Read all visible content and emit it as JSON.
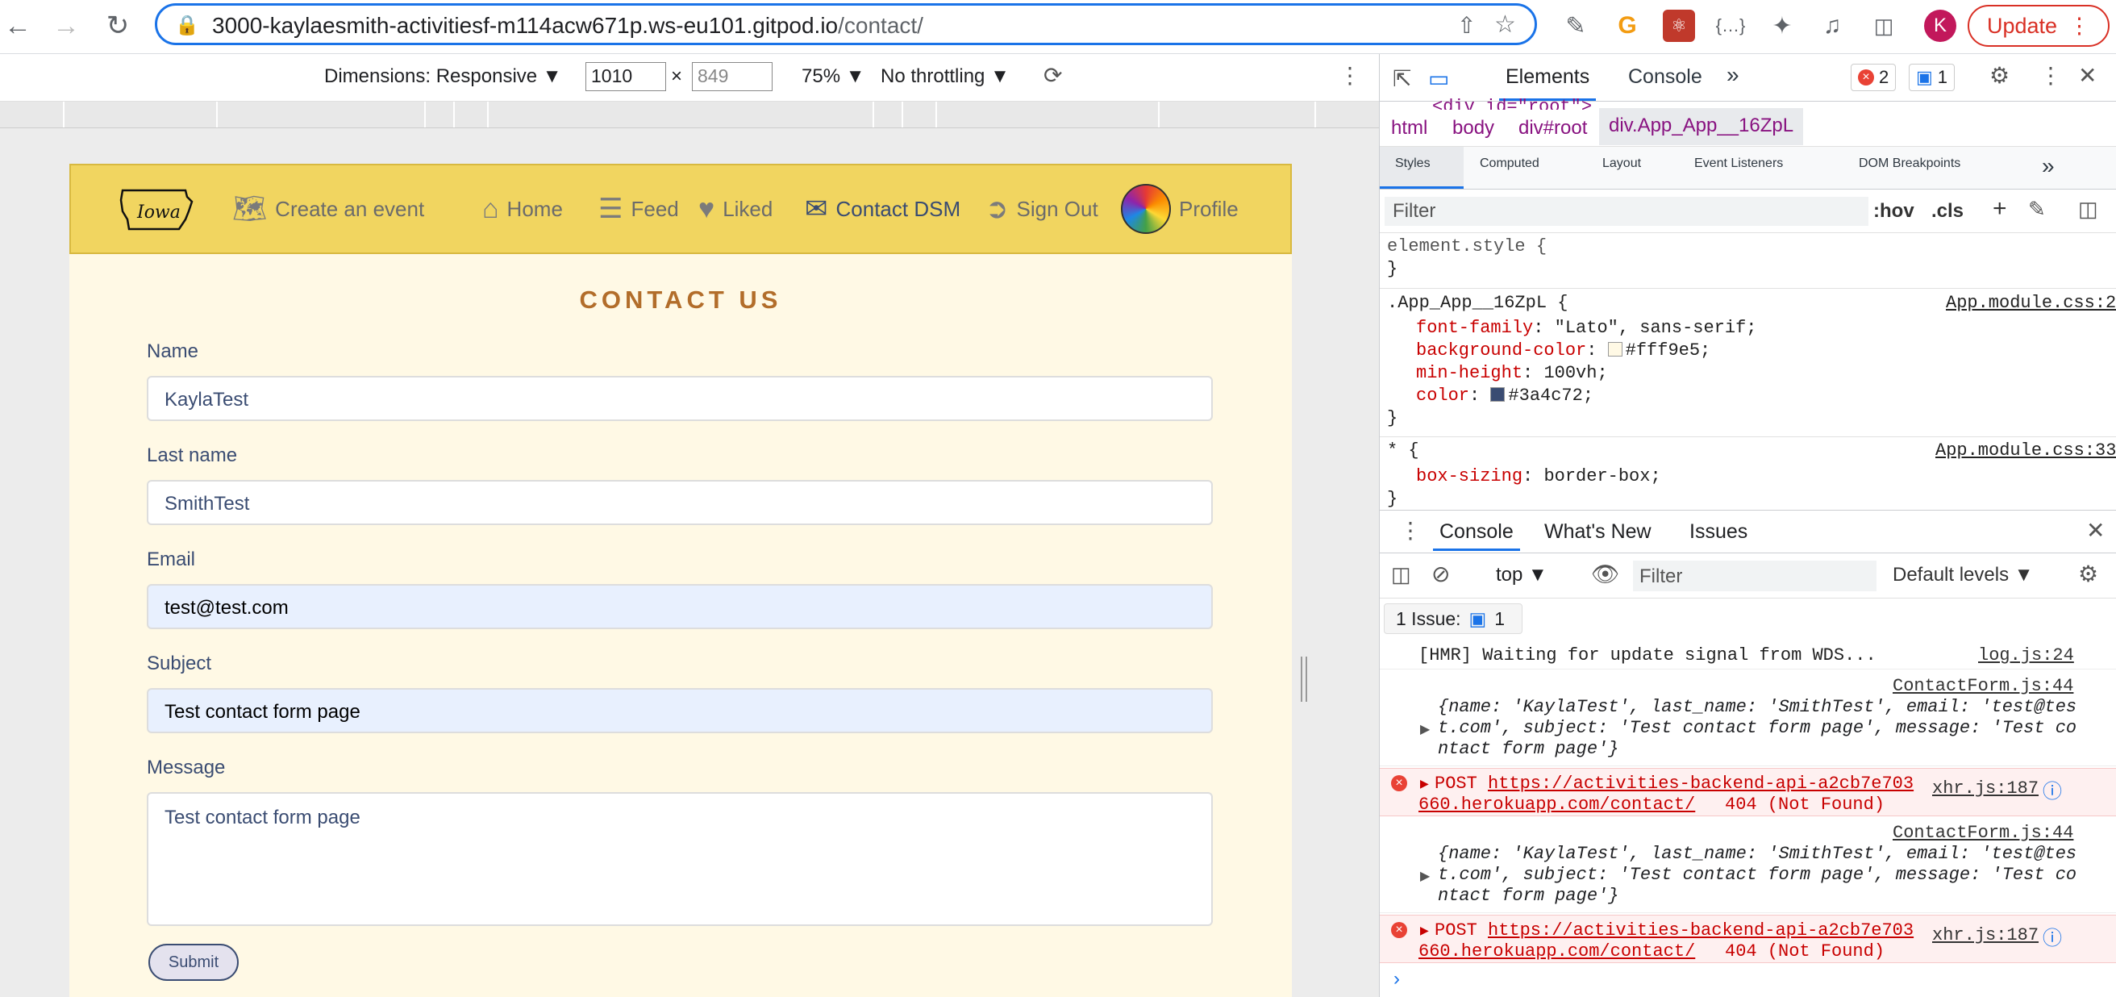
{
  "browser": {
    "url_host": "3000-kaylaesmith-activitiesf-m114acw671p.ws-eu101.gitpod.io",
    "url_path": "/contact/",
    "update_label": "Update",
    "avatar_letter": "K"
  },
  "device_toolbar": {
    "dimensions_label": "Dimensions: Responsive",
    "width": "1010",
    "height": "849",
    "zoom": "75%",
    "throttling": "No throttling"
  },
  "site": {
    "nav": [
      {
        "label": "Create an event",
        "icon": "map-icon"
      },
      {
        "label": "Home",
        "icon": "home-icon"
      },
      {
        "label": "Feed",
        "icon": "feed-icon"
      },
      {
        "label": "Liked",
        "icon": "heart-icon"
      },
      {
        "label": "Contact DSM",
        "icon": "envelope-icon"
      },
      {
        "label": "Sign Out",
        "icon": "sign-out-icon"
      },
      {
        "label": "Profile",
        "icon": "avatar"
      }
    ],
    "logo_text": "Iowa",
    "title": "CONTACT US",
    "form": {
      "name_label": "Name",
      "name_value": "KaylaTest",
      "last_name_label": "Last name",
      "last_name_value": "SmithTest",
      "email_label": "Email",
      "email_value": "test@test.com",
      "subject_label": "Subject",
      "subject_value": "Test contact form page",
      "message_label": "Message",
      "message_value": "Test contact form page",
      "submit_label": "Submit"
    }
  },
  "devtools": {
    "tabs": {
      "elements": "Elements",
      "console": "Console",
      "more": "»"
    },
    "errors_count": "2",
    "messages_count": "1",
    "truncated_line": "<div id=\"root\">",
    "breadcrumbs": [
      "html",
      "body",
      "div#root",
      "div.App_App__16ZpL"
    ],
    "styles_tabs": [
      "Styles",
      "Computed",
      "Layout",
      "Event Listeners",
      "DOM Breakpoints",
      "»"
    ],
    "filter_placeholder": "Filter",
    "hov": ":hov",
    "cls": ".cls",
    "rules": {
      "element_style": "element.style {",
      "close": "}",
      "app_selector": ".App_App__16ZpL {",
      "app_source": "App.module.css:2",
      "font_family_prop": "font-family",
      "font_family_val": "\"Lato\", sans-serif;",
      "bg_prop": "background-color",
      "bg_val": "#fff9e5;",
      "min_height_prop": "min-height",
      "min_height_val": "100vh;",
      "color_prop": "color",
      "color_val": "#3a4c72;",
      "star_selector": "* {",
      "star_source": "App.module.css:33",
      "box_sizing_prop": "box-sizing",
      "box_sizing_val": "border-box;"
    },
    "drawer_tabs": [
      "Console",
      "What's New",
      "Issues"
    ],
    "console_context": "top",
    "console_filter": "Filter",
    "default_levels": "Default levels",
    "issue_label": "1 Issue:",
    "issue_count": "1",
    "logs": {
      "hmr": "[HMR] Waiting for update signal from WDS...",
      "hmr_src": "log.js:24",
      "cf_src": "ContactForm.js:44",
      "obj_line1": "{name: 'KaylaTest', last_name: 'SmithTest', email: 'test@tes",
      "obj_line2": "t.com', subject: 'Test contact form page', message: 'Test co",
      "obj_line3": "ntact form page'}",
      "post": "POST",
      "post_url1": "https://activities-backend-api-a2cb7e703",
      "post_url2": "660.herokuapp.com/contact/",
      "post_status": "404 (Not Found)",
      "xhr_src": "xhr.js:187"
    }
  },
  "colors": {
    "site_bg": "#fff9e5",
    "site_text": "#3a4c72",
    "nav_bg": "#f1d560",
    "title": "#b26d2a",
    "chrome_accent": "#1a73e8",
    "error": "#c80000"
  }
}
